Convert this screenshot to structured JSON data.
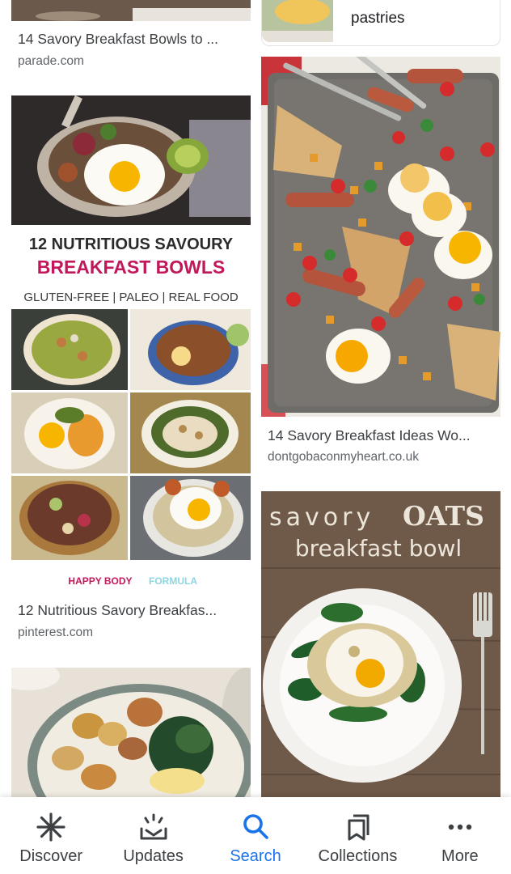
{
  "results": [
    {
      "title": "14 Savory Breakfast Bowls to ...",
      "source": "parade.com"
    },
    {
      "title": "pastries",
      "source": ""
    },
    {
      "title": "14 Savory Breakfast Ideas Wo...",
      "source": "dontgobaconmyheart.co.uk"
    },
    {
      "title": "12 Nutritious Savory Breakfas...",
      "source": "pinterest.com"
    }
  ],
  "pin_image": {
    "headline_line1": "12 NUTRITIOUS SAVOURY",
    "headline_line2": "BREAKFAST BOWLS",
    "tags": "GLUTEN-FREE | PALEO | REAL FOOD",
    "brand_part1": "HAPPY BODY",
    "brand_part2": "FORMULA"
  },
  "oats_image": {
    "line1_light": "savory",
    "line1_bold": "OATS",
    "line2": "breakfast bowl"
  },
  "bottom_nav": [
    {
      "label": "Discover",
      "icon": "asterisk-icon",
      "active": false
    },
    {
      "label": "Updates",
      "icon": "updates-icon",
      "active": false
    },
    {
      "label": "Search",
      "icon": "search-icon",
      "active": true
    },
    {
      "label": "Collections",
      "icon": "collections-icon",
      "active": false
    },
    {
      "label": "More",
      "icon": "more-dots-icon",
      "active": false
    }
  ],
  "colors": {
    "accent": "#1a73e8",
    "pin_red": "#c2185b",
    "pin_text": "#2b2b2b"
  }
}
